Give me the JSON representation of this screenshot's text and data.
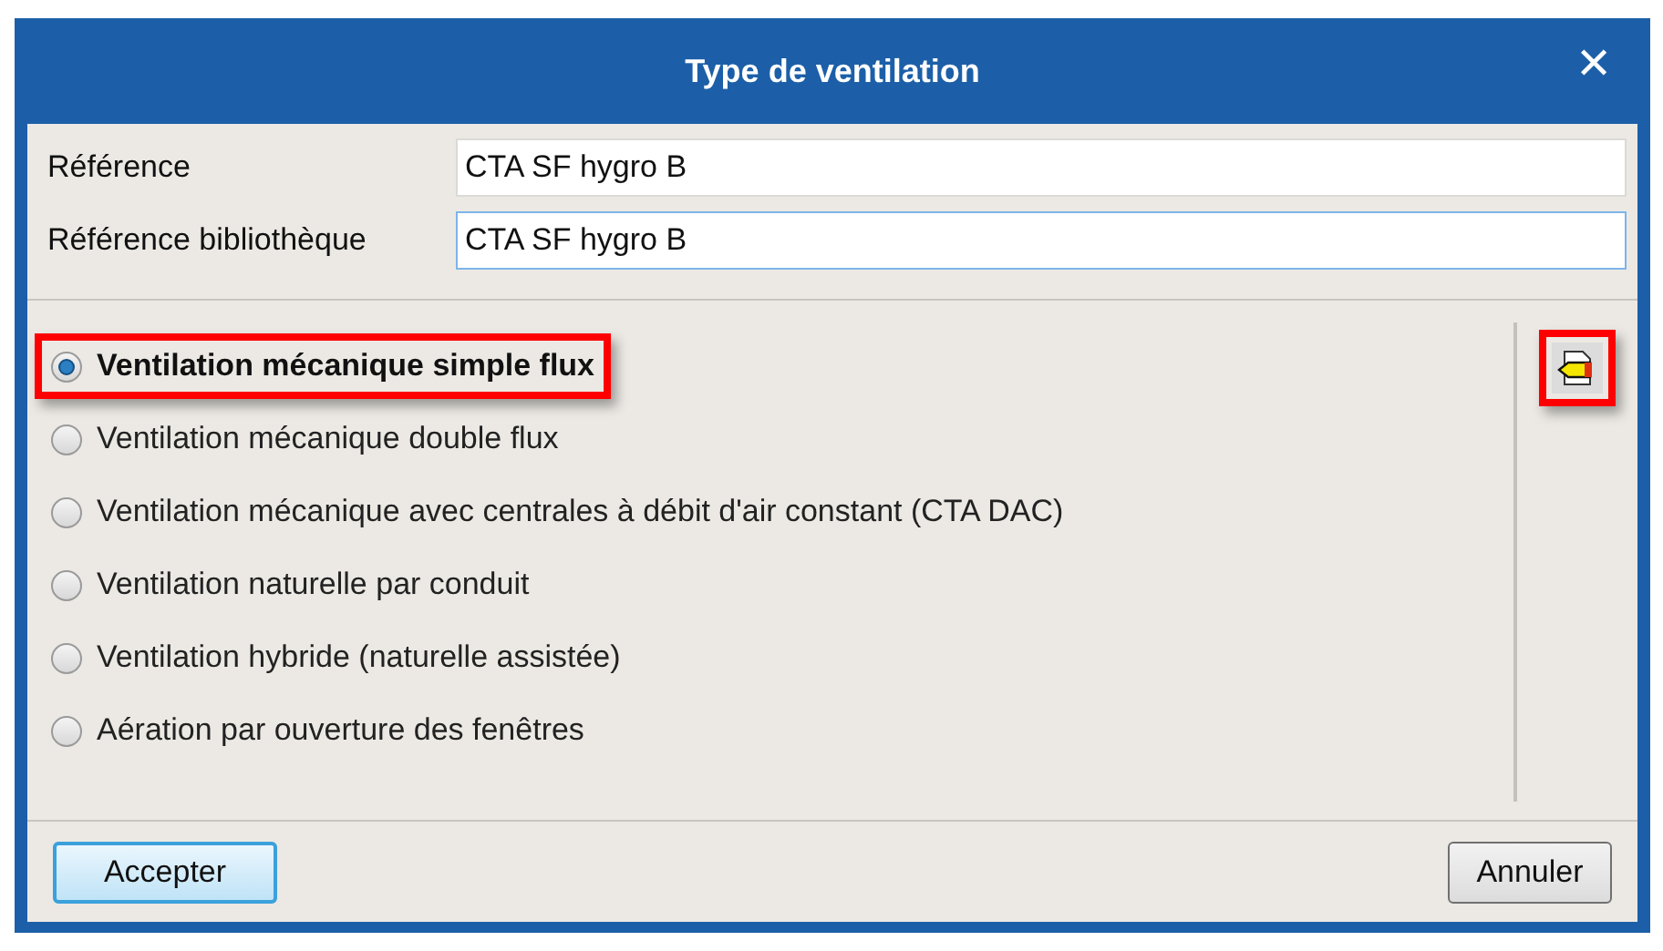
{
  "window": {
    "title": "Type de ventilation",
    "close": "✕"
  },
  "fields": [
    {
      "label": "Référence",
      "value": "CTA SF hygro B",
      "focused": false
    },
    {
      "label": "Référence bibliothèque",
      "value": "CTA SF hygro B",
      "focused": true
    }
  ],
  "options": [
    {
      "label": "Ventilation mécanique simple flux",
      "selected": true,
      "highlighted": true
    },
    {
      "label": "Ventilation mécanique double flux",
      "selected": false,
      "highlighted": false
    },
    {
      "label": "Ventilation mécanique avec centrales à débit d'air constant (CTA DAC)",
      "selected": false,
      "highlighted": false
    },
    {
      "label": "Ventilation naturelle par conduit",
      "selected": false,
      "highlighted": false
    },
    {
      "label": "Ventilation hybride (naturelle assistée)",
      "selected": false,
      "highlighted": false
    },
    {
      "label": "Aération par ouverture des fenêtres",
      "selected": false,
      "highlighted": false
    }
  ],
  "tool_button": {
    "highlighted": true
  },
  "buttons": [
    {
      "label": "Accepter",
      "default": true
    },
    {
      "label": "Annuler",
      "default": false
    }
  ]
}
